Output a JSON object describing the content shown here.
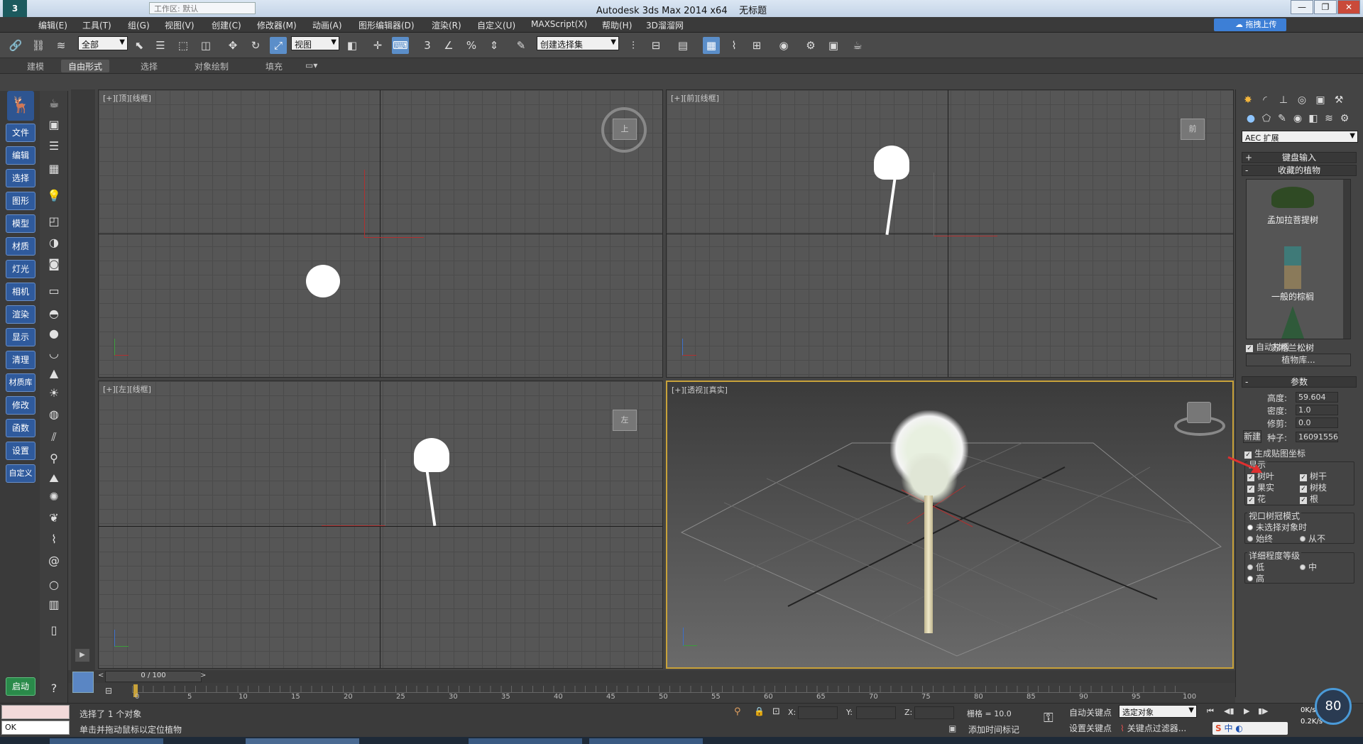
{
  "window": {
    "title": "Autodesk 3ds Max  2014 x64",
    "doc": "无标题",
    "workspace": "工作区: 默认",
    "controls": [
      "—",
      "❐",
      "✕"
    ]
  },
  "menus": [
    "编辑(E)",
    "工具(T)",
    "组(G)",
    "视图(V)",
    "创建(C)",
    "修改器(M)",
    "动画(A)",
    "图形编辑器(D)",
    "渲染(R)",
    "自定义(U)",
    "MAXScript(X)",
    "帮助(H)",
    "3D溜溜网"
  ],
  "upload_label": "拖拽上传",
  "toolbar": {
    "filter": "全部",
    "refcoord": "视图",
    "selset": "创建选择集"
  },
  "ribbon_tabs": [
    "建模",
    "自由形式",
    "选择",
    "对象绘制",
    "填充"
  ],
  "left_nav": [
    "文件",
    "编辑",
    "选择",
    "图形",
    "模型",
    "材质",
    "灯光",
    "相机",
    "渲染",
    "显示",
    "清理",
    "材质库",
    "修改",
    "函数",
    "设置",
    "自定义"
  ],
  "start_label": "启动",
  "viewports": [
    {
      "label": "[+][顶][线框]",
      "cube": "上"
    },
    {
      "label": "[+][前][线框]",
      "cube": "前"
    },
    {
      "label": "[+][左][线框]",
      "cube": "左"
    },
    {
      "label": "[+][透视][真实]",
      "cube": ""
    }
  ],
  "cmdpanel": {
    "category": "AEC 扩展",
    "rollout_keyboard": "键盘输入",
    "rollout_fav": "收藏的植物",
    "plants": [
      "孟加拉菩提树",
      "一般的棕榈",
      "苏格兰松树"
    ],
    "auto_material": "自动材质",
    "plant_lib": "植物库...",
    "rollout_params": "参数",
    "height_label": "高度:",
    "height": "59.604",
    "density_label": "密度:",
    "density": "1.0",
    "prune_label": "修剪:",
    "prune": "0.0",
    "new_label": "新建",
    "seed_label": "种子:",
    "seed": "16091556",
    "gen_map": "生成贴图坐标",
    "display_group": "显示",
    "display_items": [
      "树叶",
      "树干",
      "果实",
      "树枝",
      "花",
      "根"
    ],
    "canopy_group": "视口树冠模式",
    "canopy_opts": [
      "未选择对象时",
      "始终",
      "从不"
    ],
    "detail_group": "详细程度等级",
    "detail_opts": [
      "低",
      "中",
      "高"
    ]
  },
  "timeline": {
    "frame": "0 / 100",
    "ticks": [
      "0",
      "5",
      "10",
      "15",
      "20",
      "25",
      "30",
      "35",
      "40",
      "45",
      "50",
      "55",
      "60",
      "65",
      "70",
      "75",
      "80",
      "85",
      "90",
      "95",
      "100"
    ]
  },
  "status": {
    "selected": "选择了 1 个对象",
    "hint": "单击并拖动鼠标以定位植物",
    "listener": "OK",
    "x_label": "X:",
    "y_label": "Y:",
    "z_label": "Z:",
    "grid": "栅格 = 10.0",
    "autokey": "自动关键点",
    "setkey": "设置关键点",
    "selobj": "选定对象",
    "add_time_tag": "添加时间标记",
    "key_filter": "关键点过滤器...",
    "net_up": "0K/s",
    "net_down": "0.2K/s",
    "net_pct": "80",
    "ime": "中"
  }
}
